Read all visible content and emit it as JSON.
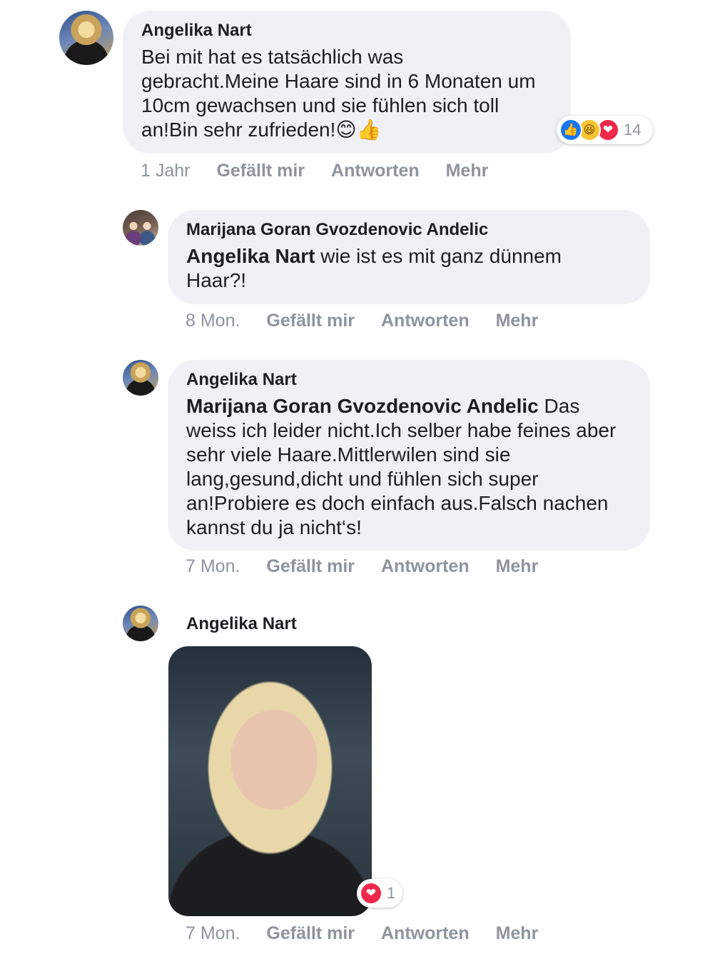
{
  "comments": [
    {
      "author": "Angelika Nart",
      "text": "Bei mit hat es tatsächlich was gebracht.Meine Haare sind in 6 Monaten um 10cm gewachsen und sie fühlen sich toll an!Bin sehr zufrieden!",
      "emoji": "😊👍",
      "time": "1 Jahr",
      "like_label": "Gefällt mir",
      "reply_label": "Antworten",
      "more_label": "Mehr",
      "reactions": {
        "icons": [
          "like-icon",
          "haha-icon",
          "love-icon"
        ],
        "count": "14"
      }
    },
    {
      "author": "Marijana Goran Gvozdenovic Andelic",
      "mention": "Angelika Nart",
      "text": " wie ist es mit ganz dünnem Haar?!",
      "time": "8 Mon.",
      "like_label": "Gefällt mir",
      "reply_label": "Antworten",
      "more_label": "Mehr"
    },
    {
      "author": "Angelika Nart",
      "mention": "Marijana Goran Gvozdenovic Andelic",
      "text": " Das weiss ich leider nicht.Ich selber habe feines aber sehr viele Haare.Mittlerwilen sind sie lang,gesund,dicht und fühlen sich super an!Probiere es doch einfach aus.Falsch nachen kannst du ja nicht‘s!",
      "time": "7 Mon.",
      "like_label": "Gefällt mir",
      "reply_label": "Antworten",
      "more_label": "Mehr"
    },
    {
      "author": "Angelika Nart",
      "time": "7 Mon.",
      "like_label": "Gefällt mir",
      "reply_label": "Antworten",
      "more_label": "Mehr",
      "reactions": {
        "icons": [
          "love-icon"
        ],
        "count": "1"
      }
    }
  ]
}
